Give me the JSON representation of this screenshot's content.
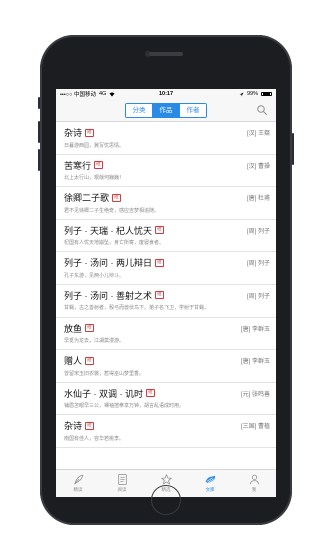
{
  "status_bar": {
    "carrier": "•••○○ 中国移动",
    "network": "4G",
    "time": "10:17",
    "battery": "99%"
  },
  "segmented_control": {
    "items": [
      {
        "label": "分类",
        "active": false
      },
      {
        "label": "作品",
        "active": true
      },
      {
        "label": "作者",
        "active": false
      }
    ]
  },
  "list": {
    "items": [
      {
        "title": "杂诗",
        "tag": "短",
        "meta": "[汉] 王粲",
        "excerpt": "日暮游西园，冀写忧思情。"
      },
      {
        "title": "苦寒行",
        "tag": "短",
        "meta": "[汉] 曹操",
        "excerpt": "北上太行山，艰哉何巍巍！"
      },
      {
        "title": "徐卿二子歌",
        "tag": "短",
        "meta": "[唐] 杜甫",
        "excerpt": "君不见徐卿二子生绝奇，感应吉梦相追随。"
      },
      {
        "title": "列子 · 天瑞 · 杞人忧天",
        "tag": "短",
        "meta": "[周] 列子",
        "excerpt": "杞国有人忧天地崩坠，身亡所寄，废寝食者。"
      },
      {
        "title": "列子 · 汤问 · 两儿辩日",
        "tag": "短",
        "meta": "[周] 列子",
        "excerpt": "孔子东游，见两小儿辩斗。"
      },
      {
        "title": "列子 · 汤问 · 善射之术",
        "tag": "短",
        "meta": "[周] 列子",
        "excerpt": "甘蝇，古之善射者，彀弓而兽伏鸟下。弟子名飞卫，学射于甘蝇，"
      },
      {
        "title": "放鱼",
        "tag": "短",
        "meta": "[唐] 李群玉",
        "excerpt": "早觅为龙去，江湖莫漫游。"
      },
      {
        "title": "赠人",
        "tag": "短",
        "meta": "[唐] 李群玉",
        "excerpt": "曾留宋玉旧衣裳，惹得巫山梦里香。"
      },
      {
        "title": "水仙子 · 双调 · 讥时",
        "tag": "短",
        "meta": "[元] 张鸣善",
        "excerpt": "铺眉苫眼早三公，裸袖揎拳享万钟，胡言乱语成时用。"
      },
      {
        "title": "杂诗",
        "tag": "短",
        "meta": "[三国] 曹植",
        "excerpt": "南国有佳人，容华若桃李。"
      }
    ]
  },
  "tab_bar": {
    "tabs": [
      {
        "label": "精读",
        "icon": "quill-icon",
        "active": false
      },
      {
        "label": "阅读",
        "icon": "book-icon",
        "active": false
      },
      {
        "label": "精选",
        "icon": "star-icon",
        "active": false
      },
      {
        "label": "文库",
        "icon": "library-icon",
        "active": true
      },
      {
        "label": "我",
        "icon": "person-icon",
        "active": false
      }
    ]
  },
  "colors": {
    "accent": "#2a8be6",
    "tag_red": "#d23c3c",
    "phone_body": "#1c1d21"
  }
}
